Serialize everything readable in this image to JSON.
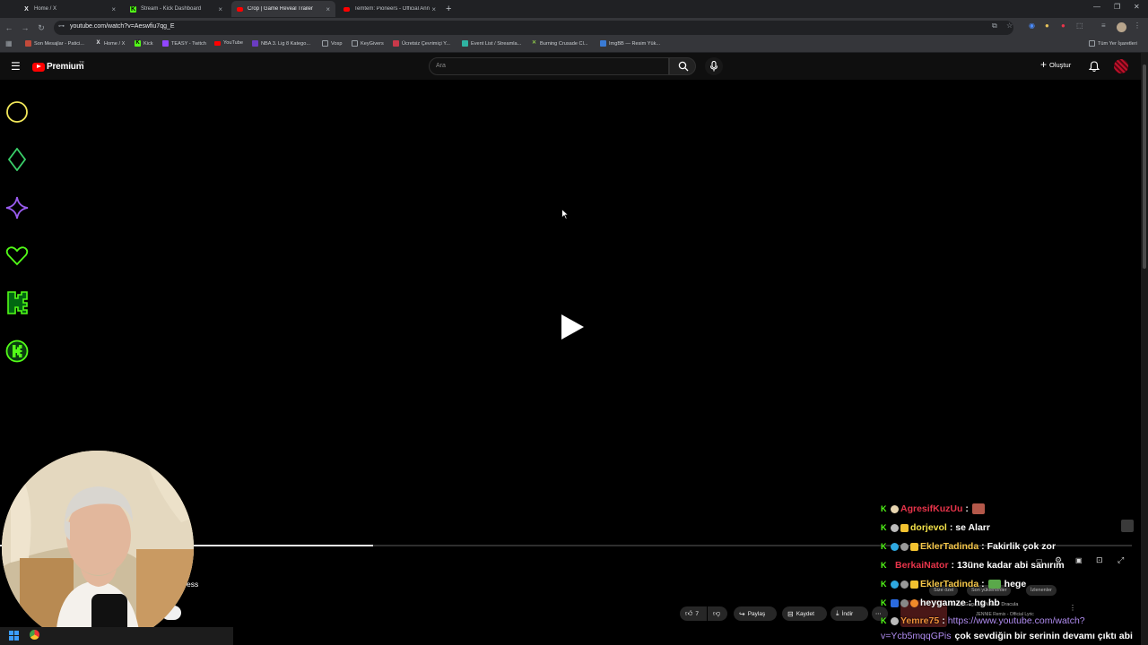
{
  "browser": {
    "tabs": [
      {
        "label": "Home / X",
        "icon": "x-logo-icon",
        "active": false
      },
      {
        "label": "Stream - Kick Dashboard",
        "icon": "kick-logo-icon",
        "active": false
      },
      {
        "label": "Crop | Game Reveal Trailer",
        "icon": "youtube-logo-icon",
        "active": true
      },
      {
        "label": "Temtem: Pioneers - Official Ann",
        "icon": "youtube-logo-icon",
        "active": false
      }
    ],
    "url": "youtube.com/watch?v=Aeswfiu7qg_E",
    "bookmarks": [
      {
        "label": "Son Mesajlar - Patici..."
      },
      {
        "label": "Home / X"
      },
      {
        "label": "Kick"
      },
      {
        "label": "TEASY - Twitch"
      },
      {
        "label": "YouTube"
      },
      {
        "label": "NBA 3. Lig 8 Katego..."
      },
      {
        "label": "Vosp"
      },
      {
        "label": "KeyGivers"
      },
      {
        "label": "Ücretsiz Çevrimiçi Y..."
      },
      {
        "label": "Event List / Streamla..."
      },
      {
        "label": "Burning Crusade Cl..."
      },
      {
        "label": "ImgBB — Resim Yük..."
      }
    ],
    "bookmarks_other": "Tüm Yer İşaretleri"
  },
  "youtube": {
    "brand": "Premium",
    "region": "TR",
    "search_placeholder": "Ara",
    "create_label": "Oluştur",
    "colors": {
      "brand_red": "#ff0000",
      "header_bg": "#0f0f0f"
    }
  },
  "player": {
    "progress_fraction": 0.33,
    "title_fragment": "ess",
    "actions": {
      "likes": "7",
      "share": "Paylaş",
      "save": "Kaydet",
      "download": "İndir"
    }
  },
  "recommendations": {
    "chips": [
      "Size özel",
      "Son yüklenenler",
      "İzlenenler"
    ],
    "item_title": "Lady Gaga, JENNIE - Dracula",
    "item_subtitle": "JENNIE Remix - Official Lyric"
  },
  "chat": [
    {
      "user": "AgresifKuzUu",
      "user_color": "#e8344a",
      "text": ":",
      "emote": true
    },
    {
      "user": "dorjevol",
      "user_color": "#f4e24a",
      "text": ": se Alarr"
    },
    {
      "user": "EklerTadinda",
      "user_color": "#f7c84a",
      "text": ": Fakirlik çok zor"
    },
    {
      "user": "BerkaiNator",
      "user_color": "#e8344a",
      "text": ": 13üne kadar abi sanırım"
    },
    {
      "user": "EklerTadinda",
      "user_color": "#f7c84a",
      "text": ":",
      "extra": "hege"
    },
    {
      "user": "heygamze",
      "user_color": "#ffffff",
      "text": ": hg hb"
    },
    {
      "user": "Yemre75",
      "user_color": "#f0913a",
      "text": ":",
      "link": "https://www.youtube.com/watch?"
    },
    {
      "user": "",
      "link": "v=Ycb5mqqGPis",
      "text": "çok sevdiğin bir serinin devamı çıktı abi"
    }
  ]
}
